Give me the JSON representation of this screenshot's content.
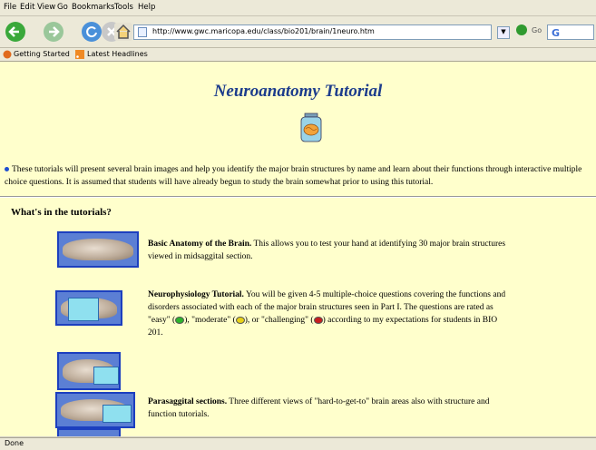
{
  "menu": [
    "File",
    "Edit",
    "View",
    "Go",
    "Bookmarks",
    "Tools",
    "Help"
  ],
  "toolbar": {
    "url": "http://www.gwc.maricopa.edu/class/bio201/brain/1neuro.htm",
    "go_label": "Go"
  },
  "bookmarks": [
    "Getting Started",
    "Latest Headlines"
  ],
  "page": {
    "title": "Neuroanatomy Tutorial",
    "intro": "These tutorials will present several brain images and help you identify the major brain structures by name and learn about their functions through interactive multiple choice questions. It is assumed that students will have already begun to study the brain somewhat prior to using this tutorial.",
    "heading": "What's in the tutorials?",
    "items": [
      {
        "title": "Basic Anatomy of the Brain.",
        "text": "This allows you to test your hand at identifying 30 major brain structures viewed in midsaggital section."
      },
      {
        "title": "Neurophysiology Tutorial.",
        "text_before": "You will be given 4-5 multiple-choice questions covering the functions and disorders associated with each of the major brain structures seen in Part I. The questions are rated as \"easy\" (",
        "text_mid1": "), \"moderate\" (",
        "text_mid2": "), or \"challenging\" (",
        "text_after": ") according to my expectations for students in BIO 201."
      },
      {
        "title": "Parasaggital sections.",
        "text": "Three different views of \"hard-to-get-to\" brain areas also with structure and function tutorials."
      }
    ]
  },
  "status": "Done",
  "colors": {
    "easy": "#2db52d",
    "moderate": "#e8d21a",
    "challenging": "#c81e1e",
    "title": "#1c3c8c"
  }
}
